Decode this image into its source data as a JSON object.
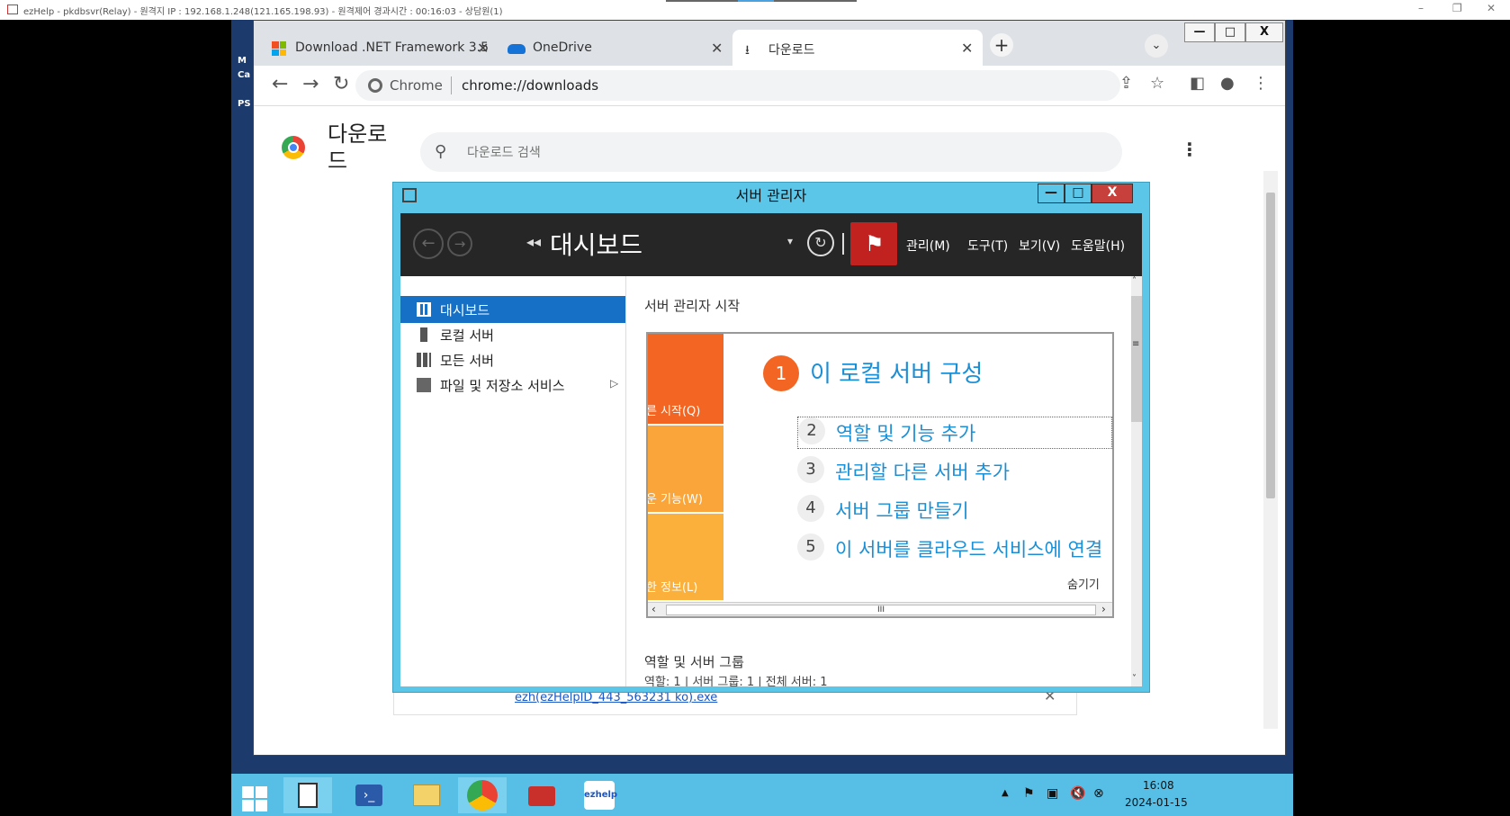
{
  "host": {
    "title": "ezHelp - pkdbsvr(Relay) - 원격지 IP : 192.168.1.248(121.165.198.93) - 원격제어 경과시간 : 00:16:03 - 상담원(1)",
    "min": "–",
    "restore": "❐",
    "close": "✕"
  },
  "desktop": {
    "left_text": "M\nCa\n\nPS"
  },
  "chrome": {
    "tabs": [
      {
        "label": "Download .NET Framework 3.5",
        "close": "✕"
      },
      {
        "label": "OneDrive",
        "close": "✕"
      },
      {
        "label": "다운로드",
        "close": "✕"
      }
    ],
    "new_tab": "+",
    "tab_search": "⌄",
    "win_min": "—",
    "win_max": "□",
    "win_close": "X",
    "back": "←",
    "forward": "→",
    "reload": "↻",
    "site_label": "Chrome",
    "url": "chrome://downloads",
    "share": "⇪",
    "star": "☆",
    "sidepanel": "◧",
    "profile": "●",
    "menu": "⋮"
  },
  "downloads": {
    "title": "다운로드",
    "search_icon": "⚲",
    "search_placeholder": "다운로드 검색",
    "menu": "⋮",
    "item_link": "ezh(ezHelpID_443_563231 ko).exe",
    "item_close": "✕"
  },
  "server_manager": {
    "title": "서버 관리자",
    "min": "—",
    "max": "□",
    "close": "X",
    "back": "←",
    "forward": "→",
    "crumb_arrow": "◂◂",
    "crumb": "대시보드",
    "drop": "▾",
    "refresh": "↻",
    "flag": "⚑",
    "menus": [
      "관리(M)",
      "도구(T)",
      "보기(V)",
      "도움말(H)"
    ],
    "nav": [
      {
        "label": "대시보드"
      },
      {
        "label": "로컬 서버"
      },
      {
        "label": "모든 서버"
      },
      {
        "label": "파일 및 저장소 서비스"
      }
    ],
    "nav_expand": "▷",
    "start_title": "서버 관리자 시작",
    "tiles": [
      "빠른 시작(Q)",
      "새로운 기능(W)",
      "자세한 정보(L)"
    ],
    "step1_num": "1",
    "step1": "이 로컬 서버 구성",
    "steps": [
      {
        "num": "2",
        "label": "역할 및 기능 추가"
      },
      {
        "num": "3",
        "label": "관리할 다른 서버 추가"
      },
      {
        "num": "4",
        "label": "서버 그룹 만들기"
      },
      {
        "num": "5",
        "label": "이 서버를 클라우드 서비스에 연결"
      }
    ],
    "hide": "숨기기",
    "hscroll_left": "‹",
    "hscroll_right": "›",
    "hscroll_grip": "III",
    "roles_title": "역할 및 서버 그룹",
    "roles_stats": "역할: 1   |   서버 그룹: 1   |   전체 서버: 1",
    "vscroll_up": "˄",
    "vscroll_grip": "≡",
    "vscroll_down": "˅"
  },
  "taskbar": {
    "time": "16:08",
    "date": "2024-01-15",
    "tray_up": "▲",
    "app_ezhelp": "ezhelp"
  }
}
